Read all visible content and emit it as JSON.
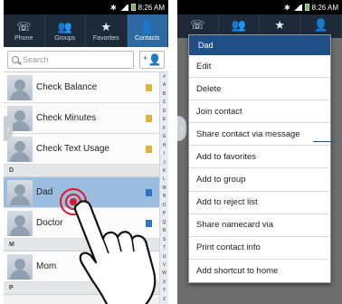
{
  "status": {
    "time": "8:26 AM"
  },
  "tabs": [
    {
      "label": "Phone",
      "icon": "phone-icon"
    },
    {
      "label": "Groups",
      "icon": "groups-icon"
    },
    {
      "label": "Favorites",
      "icon": "star-icon"
    },
    {
      "label": "Contacts",
      "icon": "contact-icon"
    }
  ],
  "search": {
    "placeholder": "Search"
  },
  "contacts_top": [
    {
      "name": "Check Balance"
    },
    {
      "name": "Check Minutes"
    },
    {
      "name": "Check Text Usage"
    }
  ],
  "sections": {
    "d": "D",
    "m": "M",
    "p": "P"
  },
  "contacts_d": [
    {
      "name": "Dad"
    },
    {
      "name": "Doctor"
    }
  ],
  "contacts_m": [
    {
      "name": "Mom"
    }
  ],
  "index_letters": [
    "#",
    "A",
    "B",
    "C",
    "D",
    "E",
    "F",
    "G",
    "H",
    "I",
    "J",
    "K",
    "L",
    "M",
    "N",
    "O",
    "P",
    "Q",
    "R",
    "S",
    "T",
    "U",
    "V",
    "W",
    "X",
    "Y",
    "Z"
  ],
  "menu": {
    "title": "Dad",
    "items": [
      "Edit",
      "Delete",
      "Join contact",
      "Share contact via message",
      "Add to favorites",
      "Add to group",
      "Add to reject list",
      "Share namecard via",
      "Print contact info",
      "Add shortcut to home"
    ]
  },
  "colors": {
    "accent": "#2d6aa3",
    "touch": "#d9182b",
    "menu_header": "#1f4f86"
  }
}
